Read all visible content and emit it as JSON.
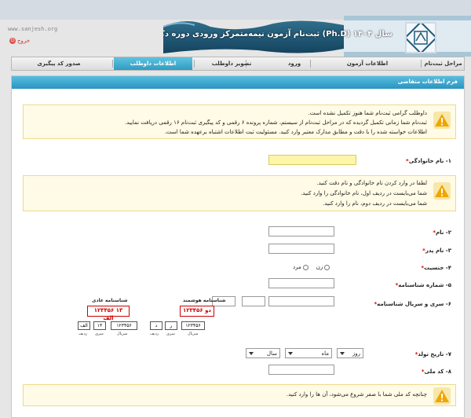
{
  "site_url": "www.sanjesh.org",
  "logout_label": "خروج",
  "banner_title": "ثبت‌نام آزمون نیمه‌متمرکز ورودی دوره دکتری (Ph.D) سال ۱۴۰۴",
  "nav": {
    "items": [
      {
        "label": "مراحل ثبت‌نام"
      },
      {
        "label": "اطلاعات آزمون"
      },
      {
        "label": "ورود"
      },
      {
        "label": "تصویر داوطلب"
      },
      {
        "label": "اطلاعات داوطلب"
      },
      {
        "label": "صدور کد پیگیری"
      }
    ]
  },
  "form": {
    "title": "فرم اطلاعات متقاضی",
    "notice1": [
      "داوطلب گرامی ثبت‌نام شما هنوز تکمیل نشده است.",
      "ثبت‌نام شما زمانی تکمیل گردیده که در مراحل ثبت‌نام از سیستم، شماره پرونده ۶ رقمی و کد پیگیری ثبت‌نام ۱۶ رقمی دریافت نمایید.",
      "اطلاعات خواسته شده را با دقت و مطابق مدارک معتبر وارد کنید. مسئولیت ثبت اطلاعات اشتباه برعهده شما است."
    ],
    "fields": {
      "family_name": "۱- نام خانوادگی",
      "first_name": "۲- نام",
      "father_name": "۳- نام پدر",
      "gender": "۴- جنسیت",
      "national_id": "۵- شماره شناسنامه",
      "id_serial": "۶- سری و سریال شناسنامه",
      "birth_date": "۷- تاریخ تولد",
      "national_code": "۸- کد ملی"
    },
    "notice2": [
      "لطفا در وارد کردن نام خانوادگی و نام دقت کنید.",
      "شما می‌بایست در ردیف اول، نام خانوادگی را وارد کنید.",
      "شما می‌بایست در ردیف دوم، نام را وارد کنید."
    ],
    "gender_options": {
      "female": "زن",
      "male": "مرد"
    },
    "id_examples": {
      "smart_title": "شناسنامه هوشمند",
      "regular_title": "شناسنامه عادی",
      "smart_number": "۱۲۳۴۵۶ دو",
      "regular_number": "۱۲۳۴۵۶ ۱۳ الف",
      "smart_row": {
        "serial": "۱۲۳۴۵۶",
        "series_letter": "د",
        "series_num": "ر",
        "cap_serial": "سریال",
        "cap_series": "سری",
        "cap_letter": "ردیف"
      },
      "regular_row": {
        "serial": "۱۲۳۴۵۶",
        "series_num": "۱۳",
        "series_letter": "الف",
        "cap_serial": "سریال",
        "cap_series": "سری",
        "cap_letter": "ردیف"
      }
    },
    "birth": {
      "day": "روز",
      "month": "ماه",
      "year": "سال"
    },
    "notice3": "چنانچه کد ملی شما با صفر شروع می‌شود، آن ها را وارد کنید."
  }
}
